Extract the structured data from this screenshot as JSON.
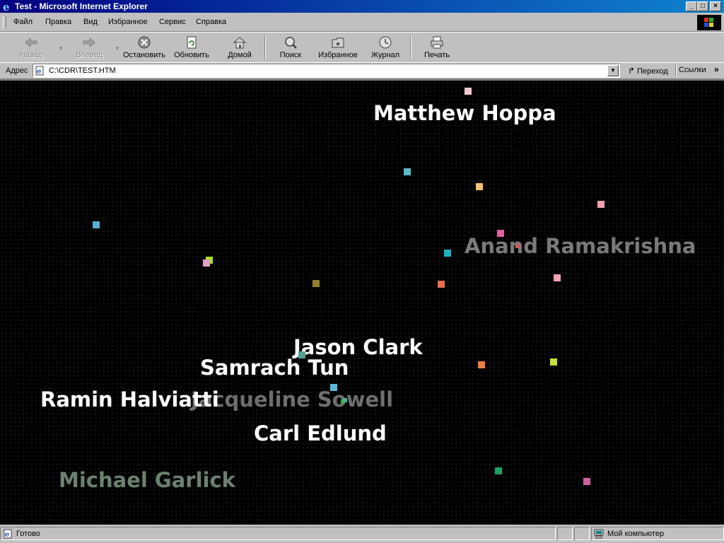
{
  "window": {
    "title": "Test - Microsoft Internet Explorer",
    "controls": {
      "minimize": "_",
      "maximize": "□",
      "close": "×"
    }
  },
  "menu": [
    "Файл",
    "Правка",
    "Вид",
    "Избранное",
    "Сервис",
    "Справка"
  ],
  "toolbar": {
    "back": "Назад",
    "forward": "Вперед",
    "stop": "Остановить",
    "refresh": "Обновить",
    "home": "Домой",
    "search": "Поиск",
    "favorites": "Избранное",
    "history": "Журнал",
    "print": "Печать"
  },
  "address": {
    "label": "Адрес",
    "value": "C:\\CDR\\TEST.HTM",
    "go": "Переход",
    "links": "Ссылки",
    "more": "»"
  },
  "page": {
    "names": [
      {
        "text": "Matthew Hoppa",
        "color": "#ffffff"
      },
      {
        "text": "Anand Ramakrishna",
        "color": "#7a7a7a"
      },
      {
        "text": "Jason Clark",
        "color": "#ffffff"
      },
      {
        "text": "Samrach Tun",
        "color": "#ffffff"
      },
      {
        "text": "Jacqueline Sowell",
        "color": "#6e6e6e"
      },
      {
        "text": "Ramin Halviatti",
        "color": "#ffffff"
      },
      {
        "text": "Carl Edlund",
        "color": "#ffffff"
      },
      {
        "text": "Michael Garlick",
        "color": "#6c8070"
      }
    ],
    "dot_colors": [
      "#f4c8d0",
      "#5ab8c8",
      "#f8c070",
      "#f0a0b0",
      "#5ab0d0",
      "#e060a0",
      "#20b0c0",
      "#a8e020",
      "#e0a0c0",
      "#d06060",
      "#908030",
      "#e87050",
      "#f0a0b0",
      "#40b040",
      "#e88040",
      "#c8e040",
      "#50a090",
      "#5ab8d8",
      "#50b0a0",
      "#20a060",
      "#d060a0"
    ]
  },
  "status": {
    "text": "Готово",
    "zone": "Мой компьютер"
  }
}
